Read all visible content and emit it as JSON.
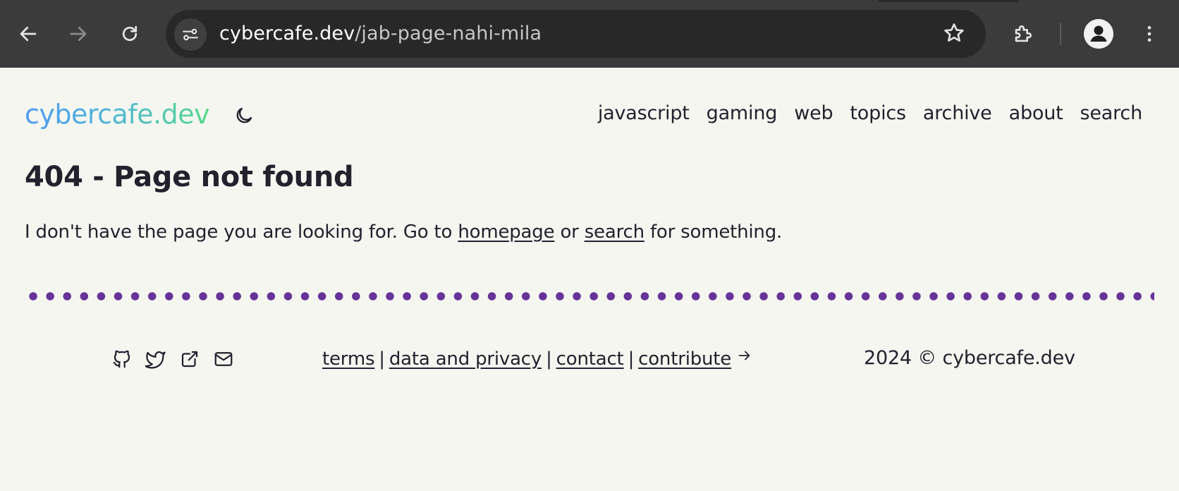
{
  "browser": {
    "url_domain": "cybercafe.dev",
    "url_path": "/jab-page-nahi-mila"
  },
  "site": {
    "logo": "cybercafe.dev"
  },
  "nav": {
    "items": [
      "javascript",
      "gaming",
      "web",
      "topics",
      "archive",
      "about",
      "search"
    ]
  },
  "main": {
    "title": "404 - Page not found",
    "message_pre": "I don't have the page you are looking for. Go to ",
    "homepage_link": "homepage",
    "message_mid": " or ",
    "search_link": "search",
    "message_post": " for something."
  },
  "footer": {
    "links": [
      "terms",
      "data and privacy",
      "contact",
      "contribute"
    ],
    "separator": "|",
    "copyright": "2024 © cybercafe.dev"
  },
  "colors": {
    "background": "#f6f6f1",
    "accent_purple": "#663399",
    "logo_gradient_start": "#4e9bf0",
    "logo_gradient_end": "#58d98a",
    "text": "#22212c"
  }
}
